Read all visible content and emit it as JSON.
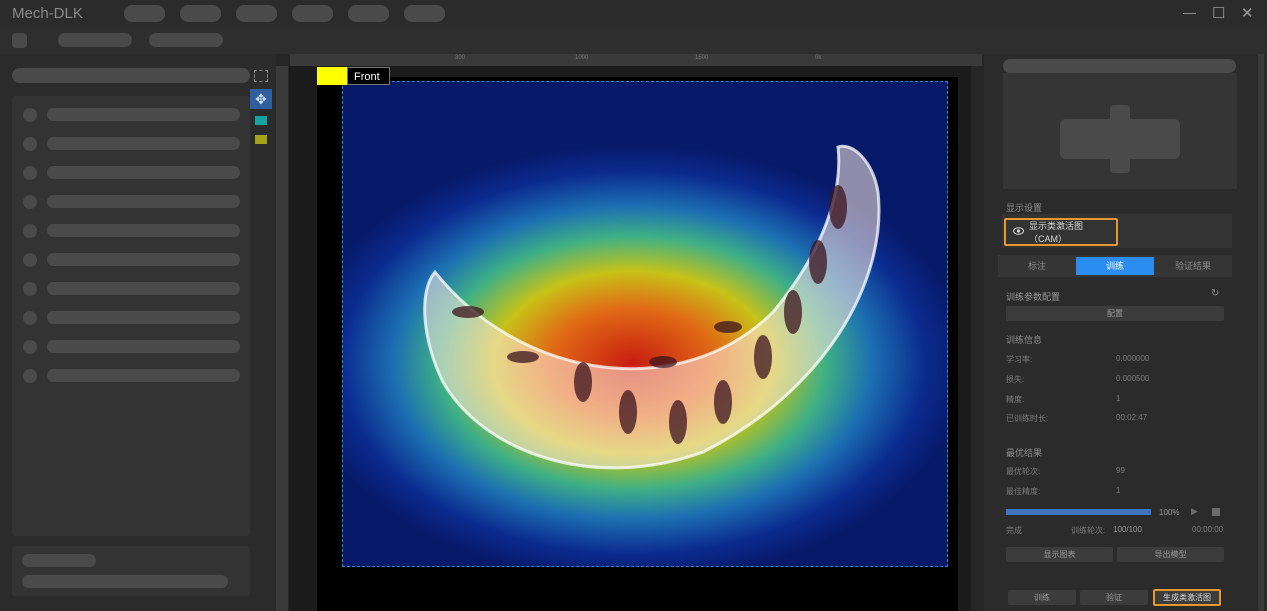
{
  "app": {
    "title": "Mech-DLK"
  },
  "window_controls": {
    "minimize": "—",
    "maximize": "☐",
    "close": "✕"
  },
  "canvas": {
    "label_name": "Front",
    "label_color": "#ffff00",
    "ruler_ticks": [
      "300",
      "1000",
      "1500",
      "0k"
    ]
  },
  "display_settings": {
    "heading": "显示设置",
    "cam_label": "显示类激活图（CAM）"
  },
  "tabs": [
    {
      "label": "标注",
      "active": false
    },
    {
      "label": "训练",
      "active": true
    },
    {
      "label": "验证结果",
      "active": false
    }
  ],
  "train_config": {
    "heading": "训练参数配置",
    "config_button": "配置"
  },
  "train_info": {
    "heading": "训练信息",
    "rows": [
      {
        "label": "学习率:",
        "value": "0.000000"
      },
      {
        "label": "损失:",
        "value": "0.000500"
      },
      {
        "label": "精度:",
        "value": "1"
      },
      {
        "label": "已训练时长:",
        "value": "00:02:47"
      }
    ]
  },
  "best_result": {
    "heading": "最优结果",
    "rows": [
      {
        "label": "最优轮次:",
        "value": "99"
      },
      {
        "label": "最佳精度:",
        "value": "1"
      }
    ]
  },
  "progress": {
    "fraction": 1.0,
    "percent_label": "100%",
    "status": "完成",
    "epochs_label": "训练轮次:",
    "epochs_value": "100/100",
    "time": "00:00:00"
  },
  "actions": {
    "show_chart": "显示图表",
    "export_model": "导出模型",
    "train": "训练",
    "validate": "验证",
    "generate_cam": "生成类激活图"
  },
  "colors": {
    "accent": "#2b8df0",
    "highlight": "#e29a2f",
    "background": "#2b2b2b"
  }
}
